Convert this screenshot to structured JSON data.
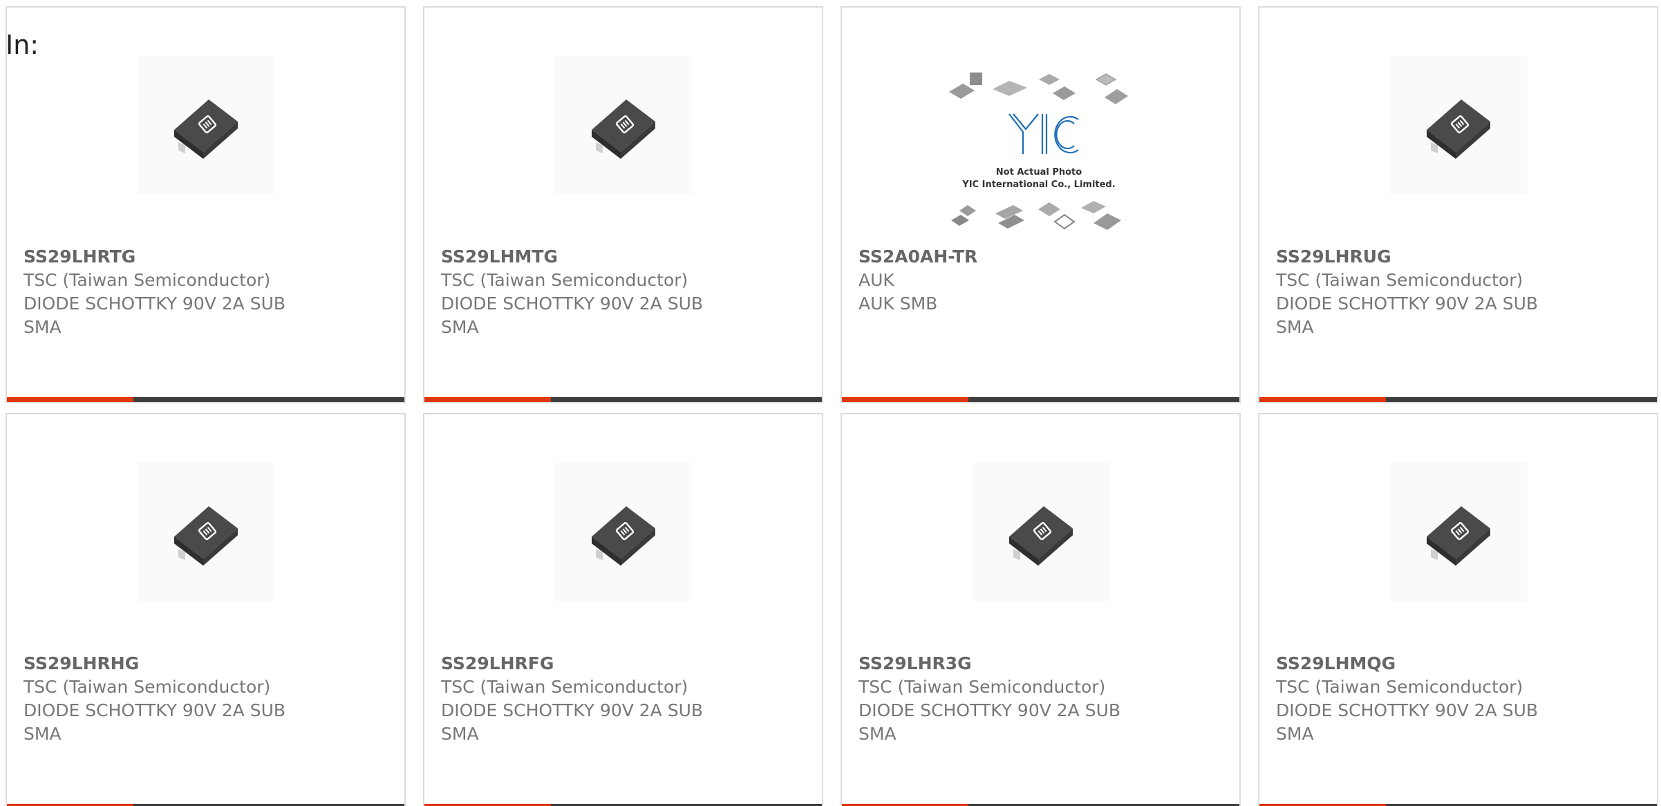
{
  "filter_label": "In:",
  "accent_color": "#e0360c",
  "bar_color": "#3e3e3e",
  "cards": [
    {
      "part_number": "SS29LHRTG",
      "manufacturer": "TSC (Taiwan Semiconductor)",
      "description": "DIODE SCHOTTKY 90V 2A SUB SMA",
      "image": "diode-package-icon"
    },
    {
      "part_number": "SS29LHMTG",
      "manufacturer": "TSC (Taiwan Semiconductor)",
      "description": "DIODE SCHOTTKY 90V 2A SUB SMA",
      "image": "diode-package-icon"
    },
    {
      "part_number": "SS2A0AH-TR",
      "manufacturer": "AUK",
      "description": "AUK SMB",
      "image": "placeholder-photo",
      "placeholder_caption_1": "Not Actual Photo",
      "placeholder_caption_2": "YIC International Co., Limited.",
      "placeholder_logo": "YIC"
    },
    {
      "part_number": "SS29LHRUG",
      "manufacturer": "TSC (Taiwan Semiconductor)",
      "description": "DIODE SCHOTTKY 90V 2A SUB SMA",
      "image": "diode-package-icon"
    },
    {
      "part_number": "SS29LHRHG",
      "manufacturer": "TSC (Taiwan Semiconductor)",
      "description": "DIODE SCHOTTKY 90V 2A SUB SMA",
      "image": "diode-package-icon"
    },
    {
      "part_number": "SS29LHRFG",
      "manufacturer": "TSC (Taiwan Semiconductor)",
      "description": "DIODE SCHOTTKY 90V 2A SUB SMA",
      "image": "diode-package-icon"
    },
    {
      "part_number": "SS29LHR3G",
      "manufacturer": "TSC (Taiwan Semiconductor)",
      "description": "DIODE SCHOTTKY 90V 2A SUB SMA",
      "image": "diode-package-icon"
    },
    {
      "part_number": "SS29LHMQG",
      "manufacturer": "TSC (Taiwan Semiconductor)",
      "description": "DIODE SCHOTTKY 90V 2A SUB SMA",
      "image": "diode-package-icon"
    }
  ]
}
